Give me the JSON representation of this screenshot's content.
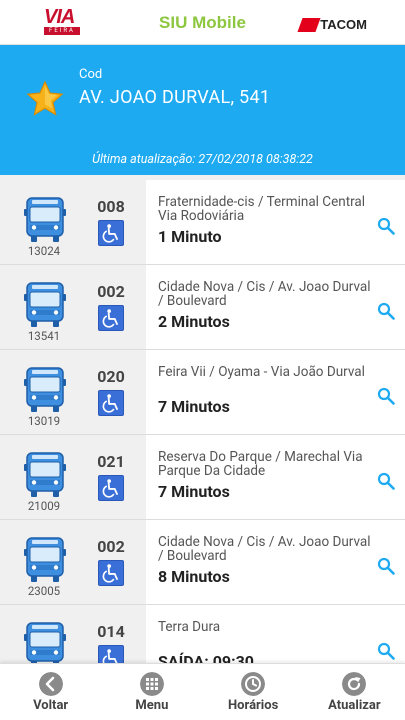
{
  "header": {
    "logo_left": "VIA",
    "logo_left_sub": "FEIRA",
    "app_title": "SIU Mobile",
    "logo_right": "TACOM"
  },
  "stop": {
    "cod_label": "Cod",
    "name": "AV. JOAO DURVAL, 541",
    "updated": "Última atualização: 27/02/2018 08:38:22",
    "favorite_icon": "star-icon"
  },
  "arrivals": [
    {
      "vehicle": "13024",
      "line": "008",
      "route": "Fraternidade-cis / Terminal Central Via Rodoviária",
      "arrival": "1 Minuto"
    },
    {
      "vehicle": "13541",
      "line": "002",
      "route": "Cidade Nova / Cis / Av. Joao Durval / Boulevard",
      "arrival": "2 Minutos"
    },
    {
      "vehicle": "13019",
      "line": "020",
      "route": "Feira Vii / Oyama - Via João Durval",
      "arrival": "7 Minutos"
    },
    {
      "vehicle": "21009",
      "line": "021",
      "route": "Reserva Do Parque / Marechal Via Parque Da Cidade",
      "arrival": "7 Minutos"
    },
    {
      "vehicle": "23005",
      "line": "002",
      "route": "Cidade Nova / Cis / Av. Joao Durval / Boulevard",
      "arrival": "8 Minutos"
    },
    {
      "vehicle": "",
      "line": "014",
      "route": "Terra Dura",
      "arrival": "SAÍDA: 09:30"
    }
  ],
  "footer": {
    "back": "Voltar",
    "menu": "Menu",
    "schedules": "Horários",
    "refresh": "Atualizar"
  },
  "colors": {
    "accent": "#1eaaf1",
    "brand_green": "#8dc63f",
    "brand_red": "#c8102e"
  }
}
